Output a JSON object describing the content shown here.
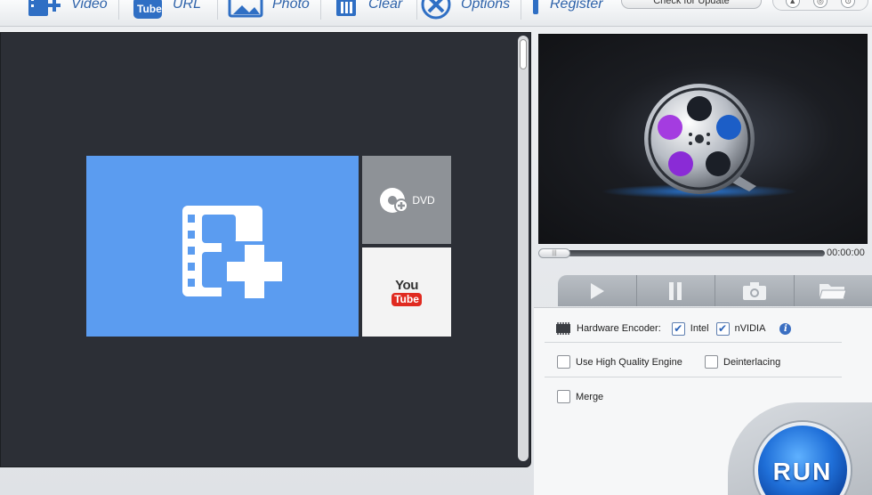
{
  "toolbar": {
    "video_label": "Video",
    "url_label": "URL",
    "photo_label": "Photo",
    "clear_label": "Clear",
    "options_label": "Options",
    "register_label": "Register",
    "update_label": "Check for Update"
  },
  "source_tiles": {
    "dvd_label": "DVD",
    "youtube_you": "You",
    "youtube_tube": "Tube",
    "url_tube": "Tube"
  },
  "player": {
    "time": "00:00:00"
  },
  "settings": {
    "hardware_encoder_label": "Hardware Encoder:",
    "intel_label": "Intel",
    "intel_checked": true,
    "nvidia_label": "nVIDIA",
    "nvidia_checked": true,
    "high_quality_label": "Use High Quality Engine",
    "high_quality_checked": false,
    "deinterlacing_label": "Deinterlacing",
    "deinterlacing_checked": false,
    "merge_label": "Merge",
    "merge_checked": false
  },
  "run_label": "RUN",
  "colors": {
    "accent_blue": "#5b9cf0",
    "panel_dark": "#2c2f36",
    "toolbar_text": "#2b5fa6",
    "youtube_red": "#e02a20"
  }
}
